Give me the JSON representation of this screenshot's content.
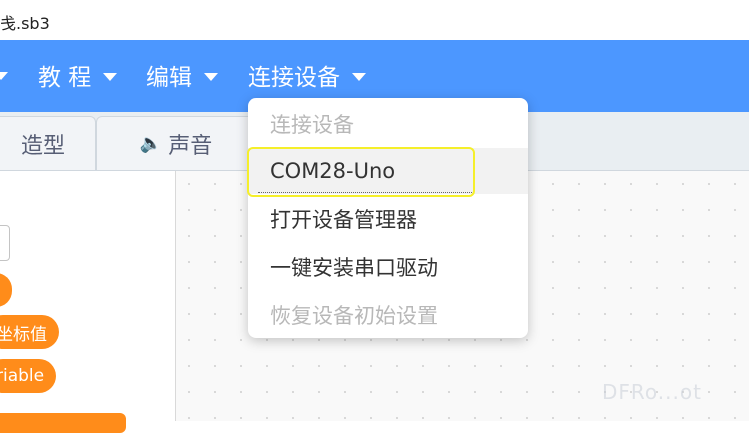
{
  "window": {
    "title": "戋.sb3"
  },
  "menubar": {
    "items": [
      {
        "label": "教 程"
      },
      {
        "label": "编辑"
      },
      {
        "label": "连接设备"
      }
    ]
  },
  "tabs": [
    {
      "label": "造型"
    },
    {
      "label": "声音",
      "icon": "speaker-icon"
    }
  ],
  "palette": {
    "blocks": [
      {
        "label": "坐标值"
      },
      {
        "label": "riable"
      }
    ]
  },
  "dropdown": {
    "header": "连接设备",
    "items": [
      {
        "label": "COM28-Uno"
      },
      {
        "label": "打开设备管理器"
      },
      {
        "label": "一键安装串口驱动"
      },
      {
        "label": "恢复设备初始设置"
      }
    ]
  },
  "watermark": "DFRo...ot",
  "colors": {
    "menubar": "#4c97ff",
    "block": "#ff8c1a",
    "highlight": "#f5ef2a"
  }
}
